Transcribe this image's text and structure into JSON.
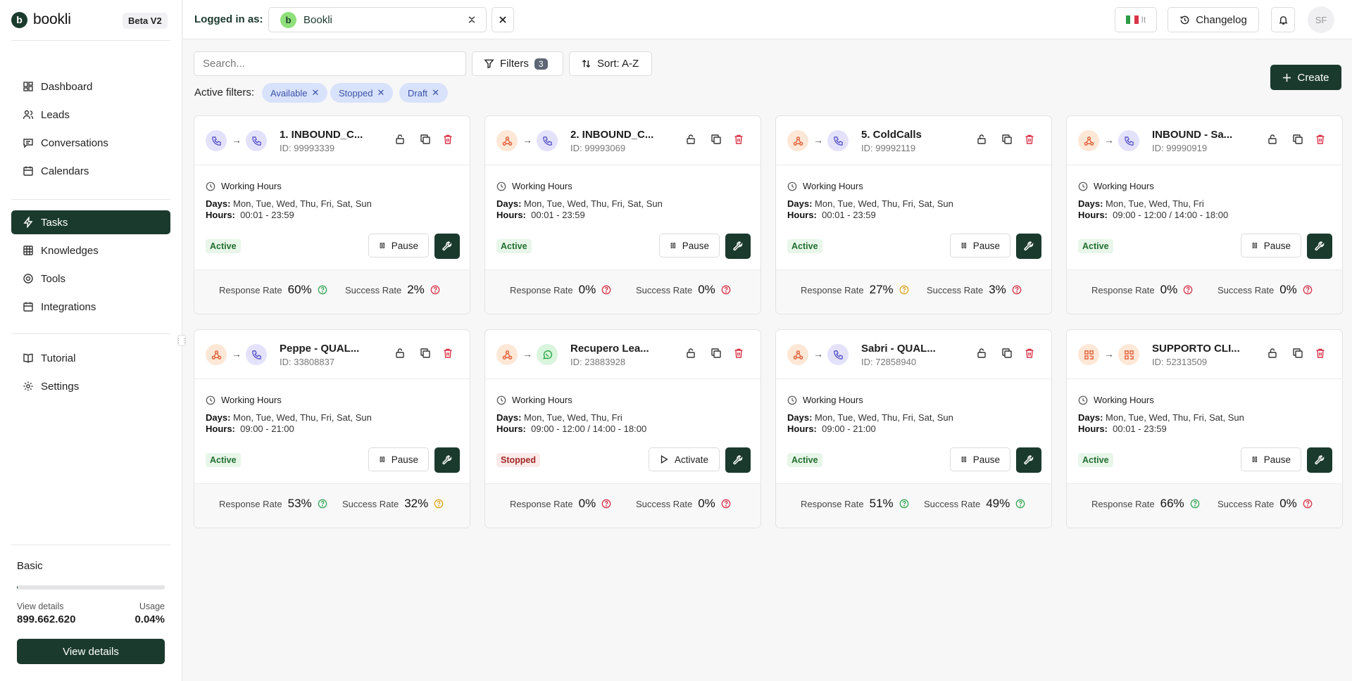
{
  "brand": {
    "name": "bookli",
    "logo_letter": "b",
    "version_badge": "Beta V2"
  },
  "nav": {
    "main": [
      {
        "label": "Dashboard",
        "icon": "dashboard-icon"
      },
      {
        "label": "Leads",
        "icon": "users-icon"
      },
      {
        "label": "Conversations",
        "icon": "chat-icon"
      },
      {
        "label": "Calendars",
        "icon": "calendar-icon"
      }
    ],
    "tools": [
      {
        "label": "Tasks",
        "icon": "bolt-icon",
        "active": true
      },
      {
        "label": "Knowledges",
        "icon": "table-icon"
      },
      {
        "label": "Tools",
        "icon": "target-icon"
      },
      {
        "label": "Integrations",
        "icon": "calendar-icon"
      }
    ],
    "help": [
      {
        "label": "Tutorial",
        "icon": "book-icon"
      },
      {
        "label": "Settings",
        "icon": "gear-icon"
      }
    ]
  },
  "plan": {
    "name": "Basic",
    "usage_fraction": 0.0004,
    "details_label": "View details",
    "details_value": "899.662.620",
    "usage_label": "Usage",
    "usage_value": "0.04%",
    "button": "View details"
  },
  "topbar": {
    "logged_in_label": "Logged in as:",
    "account": {
      "avatar_letter": "b",
      "name": "Bookli"
    },
    "lang_code": "It",
    "changelog": "Changelog",
    "user_initials": "SF"
  },
  "toolbar": {
    "search_placeholder": "Search...",
    "filters_label": "Filters",
    "filters_count": "3",
    "sort_label": "Sort: A-Z",
    "create_label": "Create",
    "active_filters_label": "Active filters:",
    "chips": [
      "Available",
      "Stopped",
      "Draft"
    ]
  },
  "labels": {
    "working_hours": "Working Hours",
    "days": "Days:",
    "hours": "Hours:",
    "response_rate": "Response Rate",
    "success_rate": "Success Rate"
  },
  "colors": {
    "brand": "#1b3a2e",
    "good": "#3aa757",
    "warn": "#e0a825",
    "bad": "#d8354a"
  },
  "cards": [
    {
      "title": "1. INBOUND_C...",
      "id": "ID: 99993339",
      "src": "phone",
      "dst": "phone",
      "days": "Mon, Tue, Wed, Thu, Fri, Sat, Sun",
      "hours": "00:01 - 23:59",
      "status": "Active",
      "action": "Pause",
      "response": "60%",
      "response_level": "good",
      "success": "2%",
      "success_level": "bad"
    },
    {
      "title": "2. INBOUND_C...",
      "id": "ID: 99993069",
      "src": "webhook",
      "dst": "phone",
      "days": "Mon, Tue, Wed, Thu, Fri, Sat, Sun",
      "hours": "00:01 - 23:59",
      "status": "Active",
      "action": "Pause",
      "response": "0%",
      "response_level": "bad",
      "success": "0%",
      "success_level": "bad"
    },
    {
      "title": "5. ColdCalls",
      "id": "ID: 99992119",
      "src": "webhook",
      "dst": "phone",
      "days": "Mon, Tue, Wed, Thu, Fri, Sat, Sun",
      "hours": "00:01 - 23:59",
      "status": "Active",
      "action": "Pause",
      "response": "27%",
      "response_level": "warn",
      "success": "3%",
      "success_level": "bad"
    },
    {
      "title": "INBOUND - Sa...",
      "id": "ID: 99990919",
      "src": "webhook",
      "dst": "phone",
      "days": "Mon, Tue, Wed, Thu, Fri",
      "hours": "09:00 - 12:00 /  14:00 - 18:00",
      "status": "Active",
      "action": "Pause",
      "response": "0%",
      "response_level": "bad",
      "success": "0%",
      "success_level": "bad"
    },
    {
      "title": "Peppe - QUAL...",
      "id": "ID: 33808837",
      "src": "webhook",
      "dst": "phone",
      "days": "Mon, Tue, Wed, Thu, Fri, Sat, Sun",
      "hours": "09:00 - 21:00",
      "status": "Active",
      "action": "Pause",
      "response": "53%",
      "response_level": "good",
      "success": "32%",
      "success_level": "warn"
    },
    {
      "title": "Recupero Lea...",
      "id": "ID: 23883928",
      "src": "webhook",
      "dst": "whatsapp",
      "days": "Mon, Tue, Wed, Thu, Fri",
      "hours": "09:00 - 12:00 /  14:00 - 18:00",
      "status": "Stopped",
      "action": "Activate",
      "response": "0%",
      "response_level": "bad",
      "success": "0%",
      "success_level": "bad"
    },
    {
      "title": "Sabri - QUAL...",
      "id": "ID: 72858940",
      "src": "webhook",
      "dst": "phone",
      "days": "Mon, Tue, Wed, Thu, Fri, Sat, Sun",
      "hours": "09:00 - 21:00",
      "status": "Active",
      "action": "Pause",
      "response": "51%",
      "response_level": "good",
      "success": "49%",
      "success_level": "good"
    },
    {
      "title": "SUPPORTO CLI...",
      "id": "ID: 52313509",
      "src": "qr",
      "dst": "qr",
      "days": "Mon, Tue, Wed, Thu, Fri, Sat, Sun",
      "hours": "00:01 - 23:59",
      "status": "Active",
      "action": "Pause",
      "response": "66%",
      "response_level": "good",
      "success": "0%",
      "success_level": "bad"
    }
  ]
}
